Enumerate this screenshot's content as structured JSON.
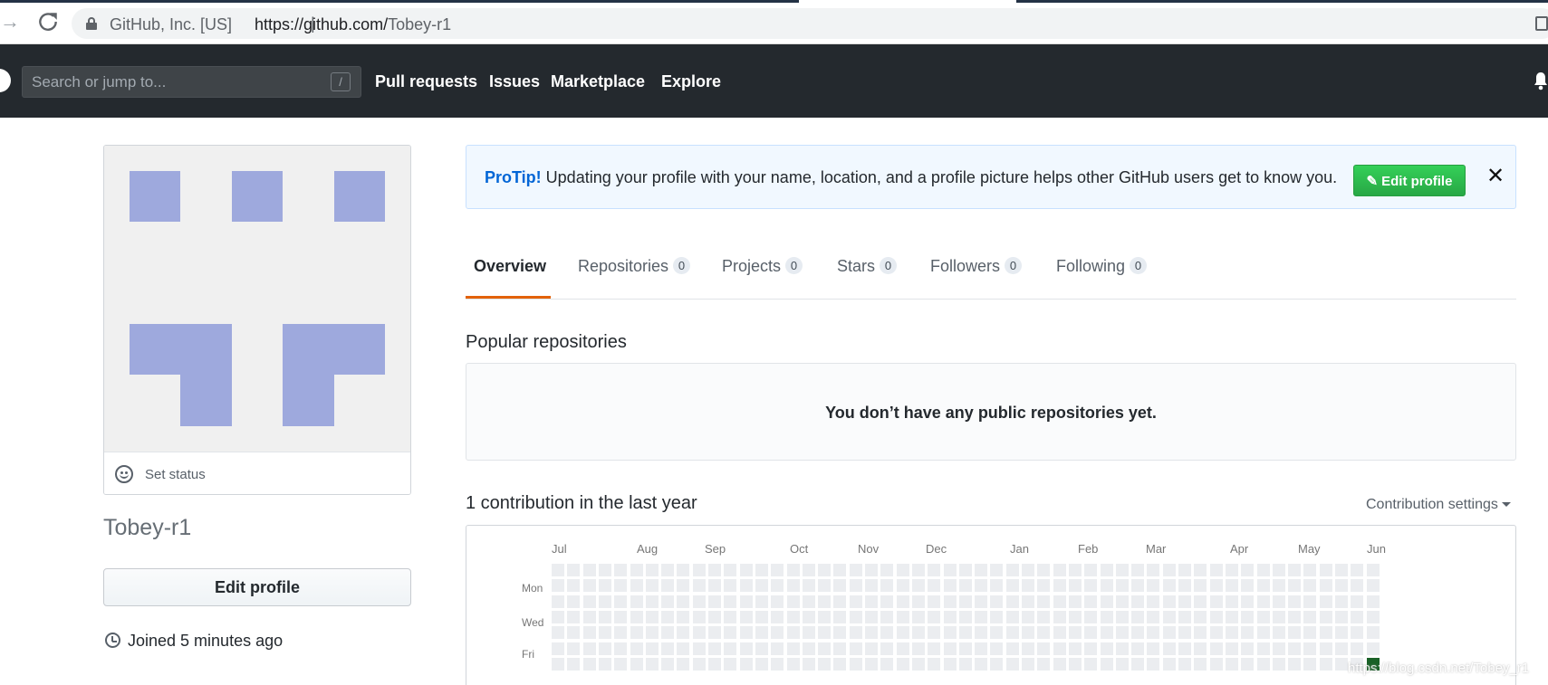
{
  "browser": {
    "site_identity": "GitHub, Inc. [US]",
    "separator": "|",
    "url_host": "https://github.com/",
    "url_path": "Tobey-r1"
  },
  "header": {
    "search_placeholder": "Search or jump to...",
    "search_shortcut": "/",
    "nav": [
      "Pull requests",
      "Issues",
      "Marketplace",
      "Explore"
    ],
    "icons": [
      "github-logo-icon",
      "notifications-bell-icon"
    ]
  },
  "profile": {
    "username": "Tobey-r1",
    "set_status_label": "Set status",
    "edit_profile_label": "Edit profile",
    "joined_text": "Joined 5 minutes ago",
    "identicon_color": "#9ea9dd"
  },
  "protip": {
    "lead": "ProTip!",
    "message": " Updating your profile with your name, location, and a profile picture helps other GitHub users get to know you.",
    "button_label": "Edit profile",
    "close_symbol": "✕"
  },
  "tabs": [
    {
      "label": "Overview",
      "count": null,
      "active": true
    },
    {
      "label": "Repositories",
      "count": "0",
      "active": false
    },
    {
      "label": "Projects",
      "count": "0",
      "active": false
    },
    {
      "label": "Stars",
      "count": "0",
      "active": false
    },
    {
      "label": "Followers",
      "count": "0",
      "active": false
    },
    {
      "label": "Following",
      "count": "0",
      "active": false
    }
  ],
  "popular": {
    "title": "Popular repositories",
    "empty_message": "You don’t have any public repositories yet."
  },
  "contributions": {
    "title": "1 contribution in the last year",
    "settings_label": "Contribution settings",
    "months": [
      "Jul",
      "Aug",
      "Sep",
      "Oct",
      "Nov",
      "Dec",
      "Jan",
      "Feb",
      "Mar",
      "Apr",
      "May",
      "Jun"
    ],
    "weekdays": [
      "Mon",
      "Wed",
      "Fri"
    ],
    "weeks": 53,
    "days_per_week": 7,
    "colors": {
      "empty": "#ebedf0",
      "level4": "#196127"
    },
    "active_cells": [
      {
        "week": 52,
        "day": 6,
        "level": 4
      }
    ]
  },
  "watermark": "https://blog.csdn.net/Tobey_r1"
}
